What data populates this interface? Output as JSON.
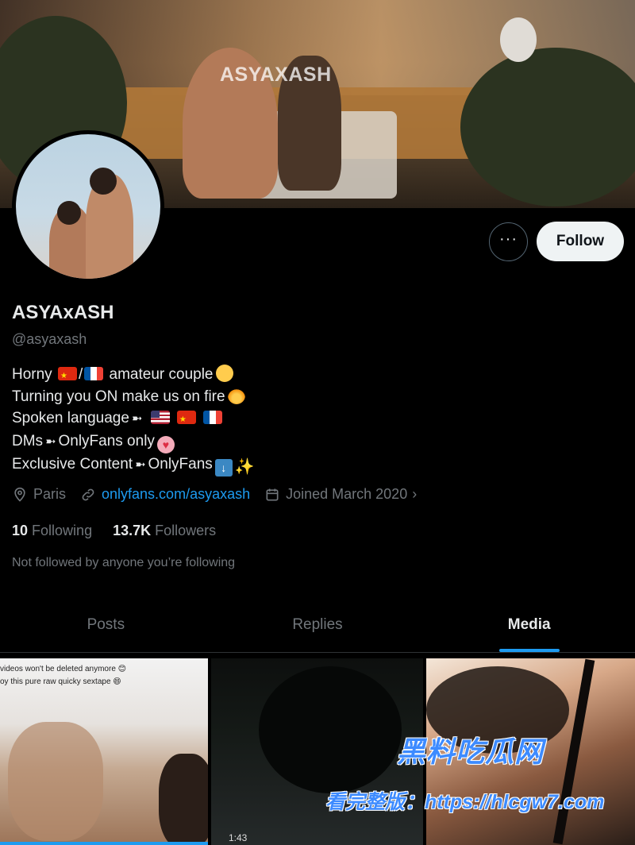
{
  "banner": {
    "watermark_text": "ASYAXASH"
  },
  "profile": {
    "display_name": "ASYAxASH",
    "handle": "@asyaxash",
    "bio": {
      "line1_a": "Horny",
      "line1_sep": "/",
      "line1_b": "amateur couple",
      "line2": "Turning you ON make us on fire",
      "line3": "Spoken language",
      "line4_a": "DMs",
      "line4_b": "OnlyFans only",
      "line5_a": "Exclusive Content",
      "line5_b": "OnlyFans",
      "arrow": "➼"
    },
    "location": "Paris",
    "website": "onlyfans.com/asyaxash",
    "joined": "Joined March 2020",
    "following_count": "10",
    "following_label": "Following",
    "followers_count": "13.7K",
    "followers_label": "Followers",
    "not_followed_text": "Not followed by anyone you’re following"
  },
  "actions": {
    "more_label": "···",
    "follow_label": "Follow"
  },
  "tabs": [
    {
      "label": "Posts",
      "active": false
    },
    {
      "label": "Replies",
      "active": false
    },
    {
      "label": "Media",
      "active": true
    }
  ],
  "media": {
    "tile1_caption_1": "videos won't be deleted anymore 😊",
    "tile1_caption_2": "oy this pure raw quicky sextape 😄",
    "tile2_counter": "1:43"
  },
  "overlay_watermark": {
    "line1": "黑料吃瓜网",
    "line2": "看完整版：https://hlcgw7.com"
  },
  "colors": {
    "accent": "#1d9bf0",
    "background": "#000000",
    "muted": "#71767b"
  }
}
